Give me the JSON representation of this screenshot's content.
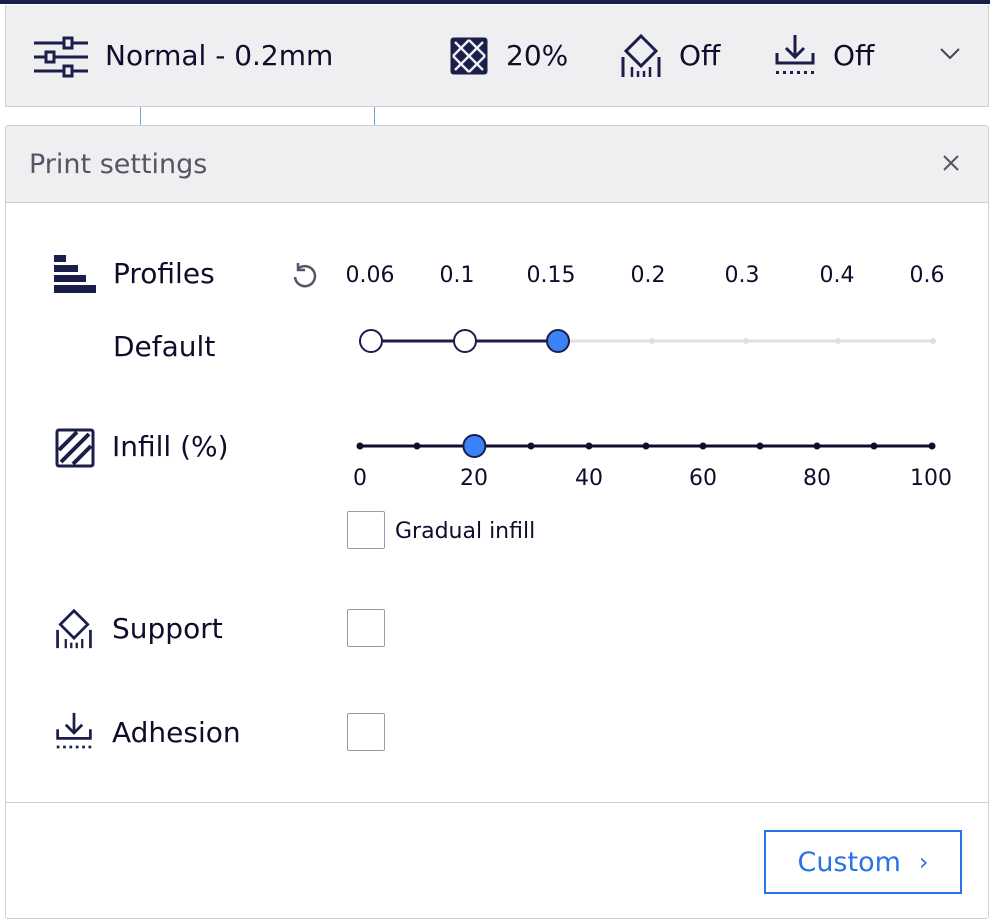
{
  "summary": {
    "profile_label": "Normal - 0.2mm",
    "infill_value": "20%",
    "support_value": "Off",
    "adhesion_value": "Off"
  },
  "panel": {
    "title": "Print settings",
    "profiles": {
      "label": "Profiles",
      "sub_label": "Default",
      "ticks": [
        "0.06",
        "0.1",
        "0.15",
        "0.2",
        "0.3",
        "0.4",
        "0.6"
      ],
      "selected_index": 2
    },
    "infill": {
      "label": "Infill (%)",
      "ticks": [
        "0",
        "20",
        "40",
        "60",
        "80",
        "100"
      ],
      "value": 20,
      "gradual_label": "Gradual infill",
      "gradual_checked": false
    },
    "support": {
      "label": "Support",
      "checked": false
    },
    "adhesion": {
      "label": "Adhesion",
      "checked": false
    },
    "custom_button_label": "Custom"
  },
  "colors": {
    "accent": "#2873e8",
    "dark_navy": "#0e0e2c",
    "track_inactive": "#e0e0e4",
    "handle_fill": "#3b82f6"
  }
}
